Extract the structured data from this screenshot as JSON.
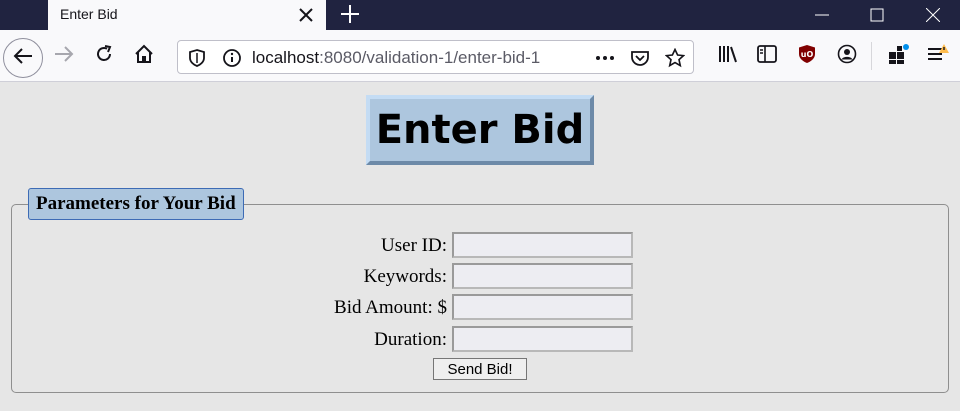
{
  "browser": {
    "tab_title": "Enter Bid",
    "url_host": "localhost",
    "url_path": ":8080/validation-1/enter-bid-1",
    "icons": {
      "tab_close": "close-icon",
      "new_tab": "plus-icon",
      "minimize": "minimize-icon",
      "maximize": "maximize-icon",
      "close_window": "close-window-icon",
      "back": "back-arrow-icon",
      "forward": "forward-arrow-icon",
      "reload": "reload-icon",
      "home": "home-icon",
      "shield": "shield-icon",
      "info": "info-icon",
      "more": "more-dots-icon",
      "pocket": "pocket-icon",
      "bookmark": "star-icon",
      "library": "library-icon",
      "sidebar": "sidebar-icon",
      "ublock": "ublock-icon",
      "account": "account-icon",
      "extensions": "extensions-icon",
      "menu": "menu-icon"
    }
  },
  "page": {
    "heading": "Enter Bid",
    "fieldset_legend": "Parameters for Your Bid",
    "fields": [
      {
        "label": "User ID:",
        "value": ""
      },
      {
        "label": "Keywords:",
        "value": ""
      },
      {
        "label": "Bid Amount: $",
        "value": ""
      },
      {
        "label": "Duration:",
        "value": ""
      }
    ],
    "submit_label": "Send Bid!"
  },
  "colors": {
    "titlebar": "#202340",
    "heading_bg": "#adc6de",
    "legend_border": "#3d6bb5",
    "page_bg": "#e6e6e6"
  }
}
